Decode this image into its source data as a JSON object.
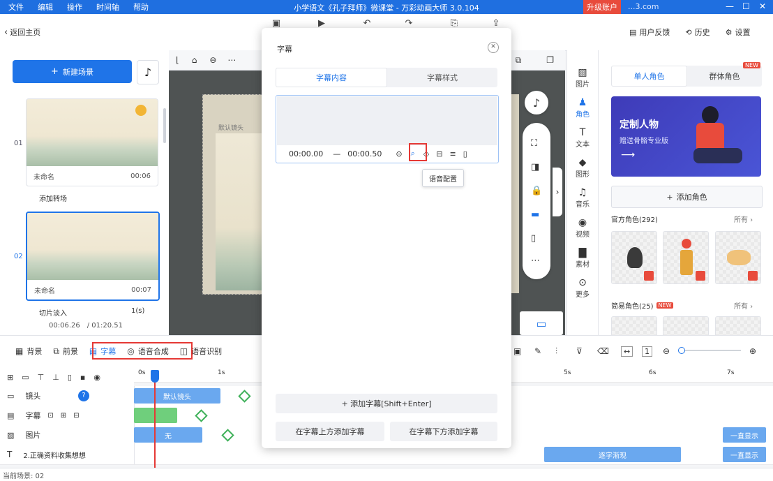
{
  "menubar": {
    "items": [
      "文件",
      "编辑",
      "操作",
      "时间轴",
      "帮助"
    ],
    "title": "小学语文《孔子拜师》微课堂 - 万彩动画大师 3.0.104",
    "upgrade": "升级账户",
    "account": "...3.com"
  },
  "topbar": {
    "back": "返回主页",
    "feedback": "用户反馈",
    "history": "历史",
    "settings": "设置"
  },
  "leftpanel": {
    "new_scene": "新建场景",
    "scenes": [
      {
        "num": "01",
        "name": "未命名",
        "duration": "00:06"
      },
      {
        "num": "02",
        "name": "未命名",
        "duration": "00:07"
      }
    ],
    "add_transition": "添加转场",
    "transition_name": "切片淡入",
    "transition_time": "1(s)",
    "time_current": "00:06.26",
    "time_total": "/ 01:20.51"
  },
  "canvas": {
    "default_lens": "默认镜头"
  },
  "righttabs": [
    "图片",
    "角色",
    "文本",
    "图形",
    "音乐",
    "视频",
    "素材",
    "更多"
  ],
  "rightpanel": {
    "tabs": [
      "单人角色",
      "群体角色"
    ],
    "new_badge": "NEW",
    "banner_title": "定制人物",
    "banner_sub": "赠送骨骼专业版",
    "add_role": "添加角色",
    "official": "官方角色(292)",
    "official_more": "所有 ›",
    "simple": "简易角色(25)",
    "simple_badge": "NEW",
    "simple_more": "所有 ›"
  },
  "timeline": {
    "tools": [
      "背景",
      "前景",
      "字幕",
      "语音合成",
      "语音识别"
    ],
    "ruler": [
      "0s",
      "1s",
      "5s",
      "6s",
      "7s"
    ],
    "tracks": [
      {
        "name": "镜头",
        "clip": "默认镜头"
      },
      {
        "name": "字幕",
        "clip": ""
      },
      {
        "name": "图片",
        "clip": "无"
      },
      {
        "name": "2.正确资料收集想想",
        "clip": "逐字渐现"
      }
    ],
    "always_show": "一直显示",
    "status": "当前场景: 02"
  },
  "modal": {
    "title": "字幕",
    "tabs": [
      "字幕内容",
      "字幕样式"
    ],
    "time_start": "00:00.00",
    "dash": "—",
    "time_end": "00:00.50",
    "tooltip": "语音配置",
    "add_subtitle": "+ 添加字幕[Shift+Enter]",
    "add_above": "在字幕上方添加字幕",
    "add_below": "在字幕下方添加字幕"
  }
}
